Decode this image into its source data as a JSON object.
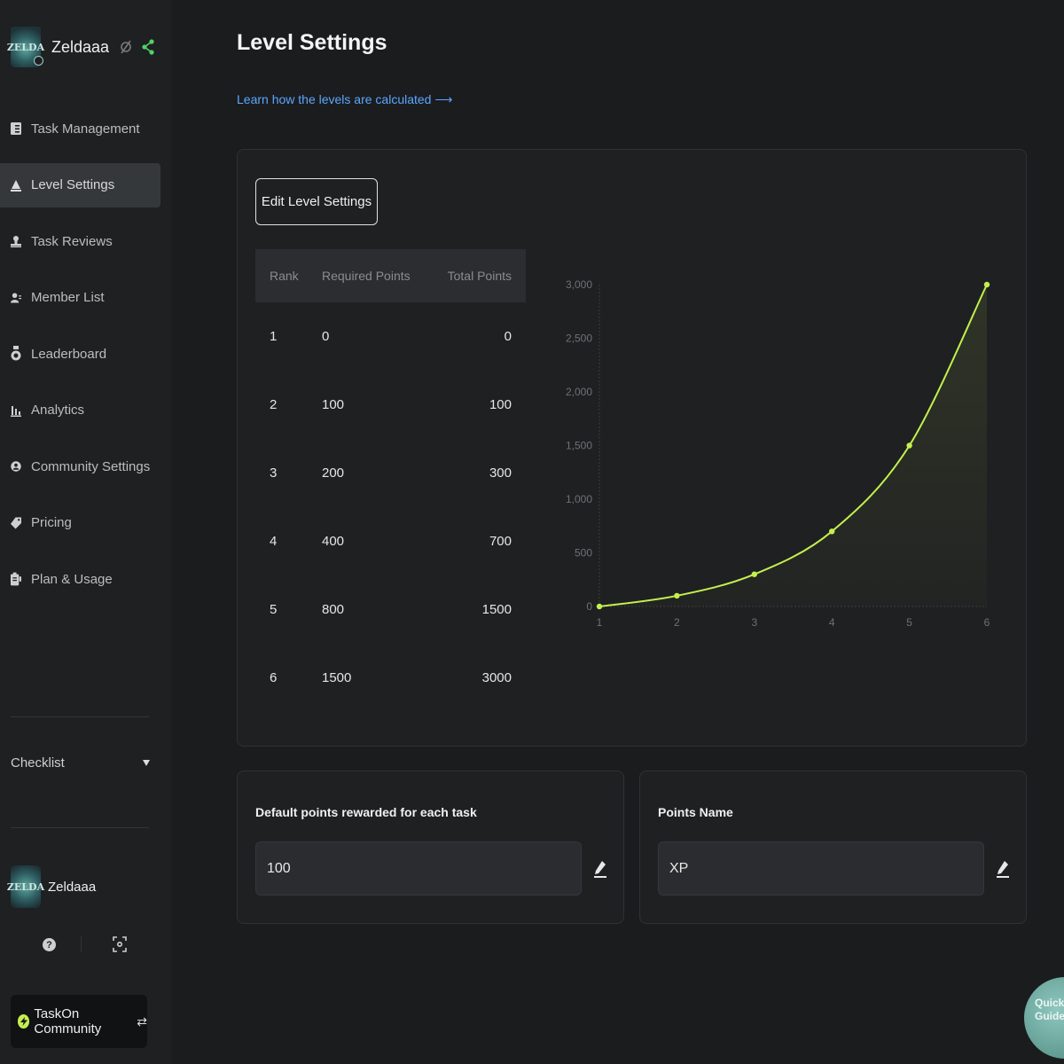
{
  "brand": {
    "name": "Zeldaaa",
    "logo_text": "ZELDA"
  },
  "sidebar": {
    "items": [
      {
        "label": "Task Management",
        "icon": "task-icon"
      },
      {
        "label": "Level Settings",
        "icon": "level-icon",
        "active": true
      },
      {
        "label": "Task Reviews",
        "icon": "review-icon"
      },
      {
        "label": "Member List",
        "icon": "members-icon"
      },
      {
        "label": "Leaderboard",
        "icon": "medal-icon"
      },
      {
        "label": "Analytics",
        "icon": "analytics-icon"
      },
      {
        "label": "Community Settings",
        "icon": "community-icon"
      },
      {
        "label": "Pricing",
        "icon": "tag-icon"
      },
      {
        "label": "Plan & Usage",
        "icon": "plan-icon"
      }
    ],
    "checklist_label": "Checklist",
    "user_name": "Zeldaaa",
    "community_label": "TaskOn Community"
  },
  "main": {
    "title": "Level Settings",
    "learn_link": "Learn how the levels are calculated ⟶",
    "edit_button": "Edit Level Settings",
    "table": {
      "headers": [
        "Rank",
        "Required Points",
        "Total Points"
      ],
      "rows": [
        [
          "1",
          "0",
          "0"
        ],
        [
          "2",
          "100",
          "100"
        ],
        [
          "3",
          "200",
          "300"
        ],
        [
          "4",
          "400",
          "700"
        ],
        [
          "5",
          "800",
          "1500"
        ],
        [
          "6",
          "1500",
          "3000"
        ]
      ]
    },
    "default_points": {
      "label": "Default points rewarded for each task",
      "value": "100"
    },
    "points_name": {
      "label": "Points Name",
      "value": "XP"
    }
  },
  "quick_guide": {
    "line1": "Quick",
    "line2": "Guide"
  },
  "colors": {
    "accent": "#c4f04e",
    "link": "#5aa7ff",
    "background": "#1b1c1e",
    "panel": "#1f2022"
  },
  "chart_data": {
    "type": "line",
    "x": [
      1,
      2,
      3,
      4,
      5,
      6
    ],
    "series": [
      {
        "values": [
          0,
          100,
          300,
          700,
          1500,
          3000
        ]
      }
    ],
    "y_ticks": [
      "0",
      "500",
      "1,000",
      "1,500",
      "2,000",
      "2,500",
      "3,000"
    ],
    "x_ticks": [
      "1",
      "2",
      "3",
      "4",
      "5",
      "6"
    ],
    "ylim": [
      0,
      3000
    ],
    "xlim": [
      1,
      6
    ],
    "grid": false
  }
}
